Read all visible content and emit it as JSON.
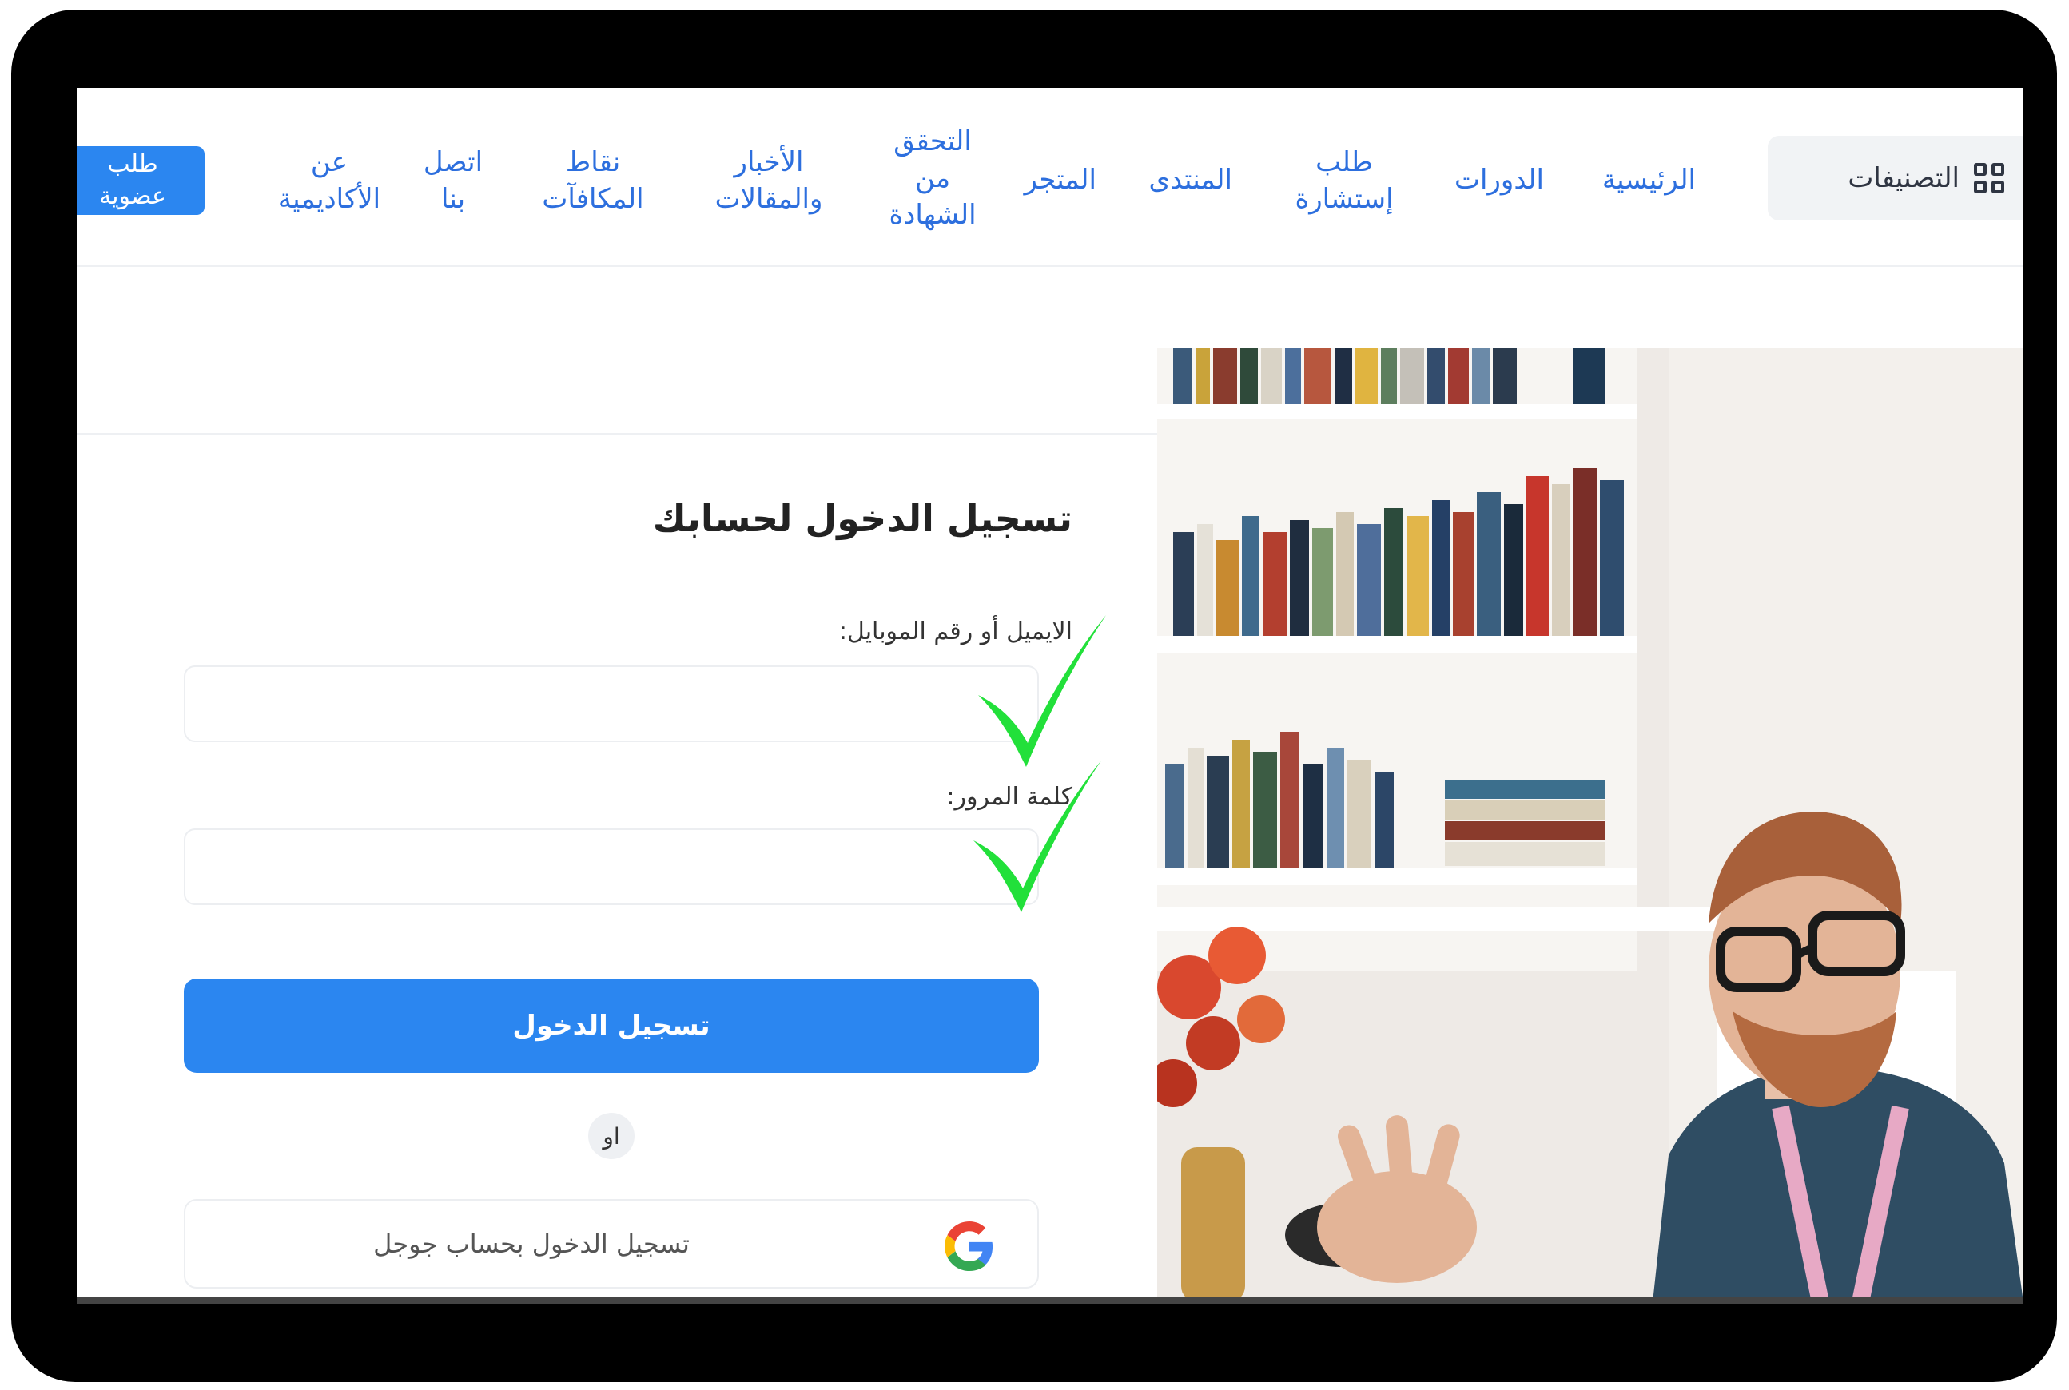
{
  "nav": {
    "categories_label": "التصنيفات",
    "items": [
      {
        "line1": "الرئيسية",
        "line2": ""
      },
      {
        "line1": "الدورات",
        "line2": ""
      },
      {
        "line1": "طلب",
        "line2": "إستشارة"
      },
      {
        "line1": "المنتدى",
        "line2": ""
      },
      {
        "line1": "المتجر",
        "line2": ""
      },
      {
        "line1": "التحقق",
        "line2": "من",
        "line3": "الشهادة"
      },
      {
        "line1": "الأخبار",
        "line2": "والمقالات"
      },
      {
        "line1": "نقاط",
        "line2": "المكافآت"
      },
      {
        "line1": "اتصل",
        "line2": "بنا"
      },
      {
        "line1": "عن",
        "line2": "الأكاديمية"
      }
    ],
    "member_button": {
      "line1": "طلب",
      "line2": "عضوية"
    }
  },
  "form": {
    "title": "تسجيل الدخول لحسابك",
    "email_label": "الايميل أو رقم الموبايل:",
    "email_value": "",
    "password_label": "كلمة المرور:",
    "password_value": "",
    "login_button": "تسجيل الدخول",
    "or_label": "او",
    "google_button": "تسجيل الدخول بحساب جوجل"
  },
  "colors": {
    "accent": "#2b86f0",
    "nav_link": "#2d6fde",
    "check_mark": "#22e03a"
  }
}
